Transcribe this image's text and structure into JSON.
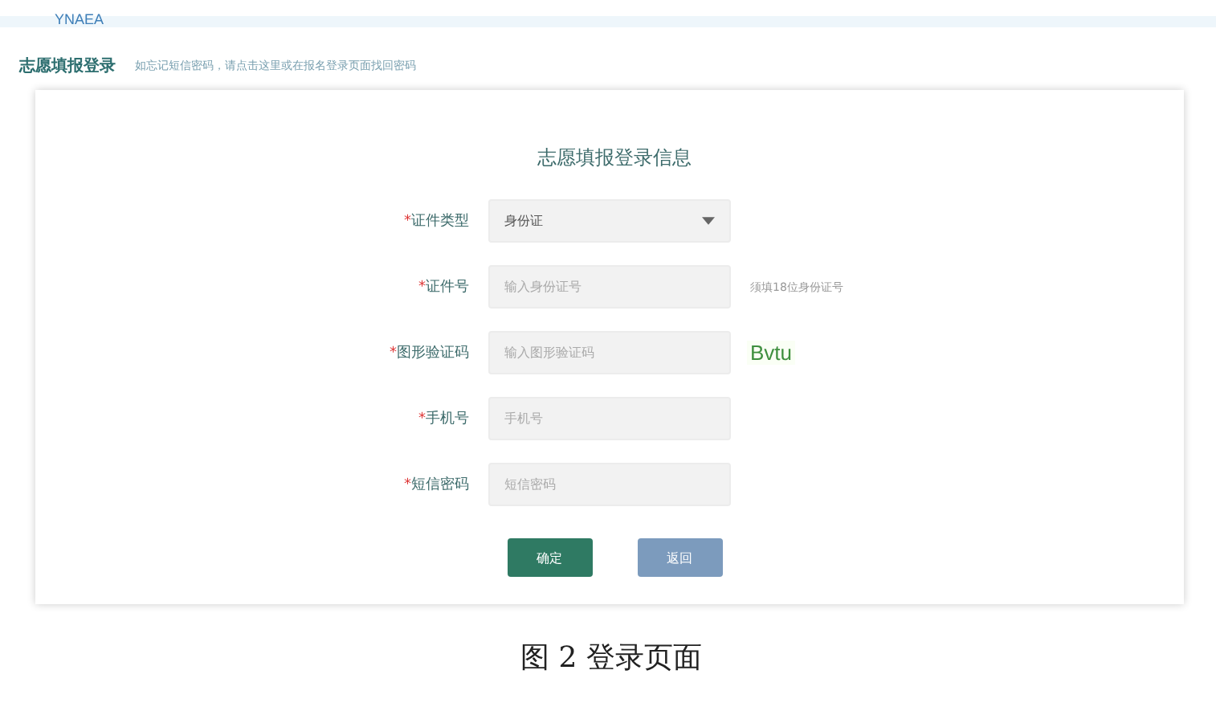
{
  "header": {
    "logo_text": "YNAEA"
  },
  "subheader": {
    "title": "志愿填报登录",
    "hint": "如忘记短信密码，请点击这里或在报名登录页面找回密码"
  },
  "form": {
    "title": "志愿填报登录信息",
    "fields": [
      {
        "kind": "select",
        "required_mark": "*",
        "label": "证件类型",
        "value": "身份证"
      },
      {
        "kind": "input",
        "required_mark": "*",
        "label": "证件号",
        "placeholder": "输入身份证号",
        "note": "须填18位身份证号"
      },
      {
        "kind": "captcha",
        "required_mark": "*",
        "label": "图形验证码",
        "placeholder": "输入图形验证码",
        "captcha": "Bvtu"
      },
      {
        "kind": "input",
        "required_mark": "*",
        "label": "手机号",
        "placeholder": "手机号"
      },
      {
        "kind": "input",
        "required_mark": "*",
        "label": "短信密码",
        "placeholder": "短信密码"
      }
    ],
    "buttons": [
      {
        "kind": "primary",
        "label": "确定"
      },
      {
        "kind": "secondary",
        "label": "返回"
      }
    ]
  },
  "caption": "图 2 登录页面"
}
